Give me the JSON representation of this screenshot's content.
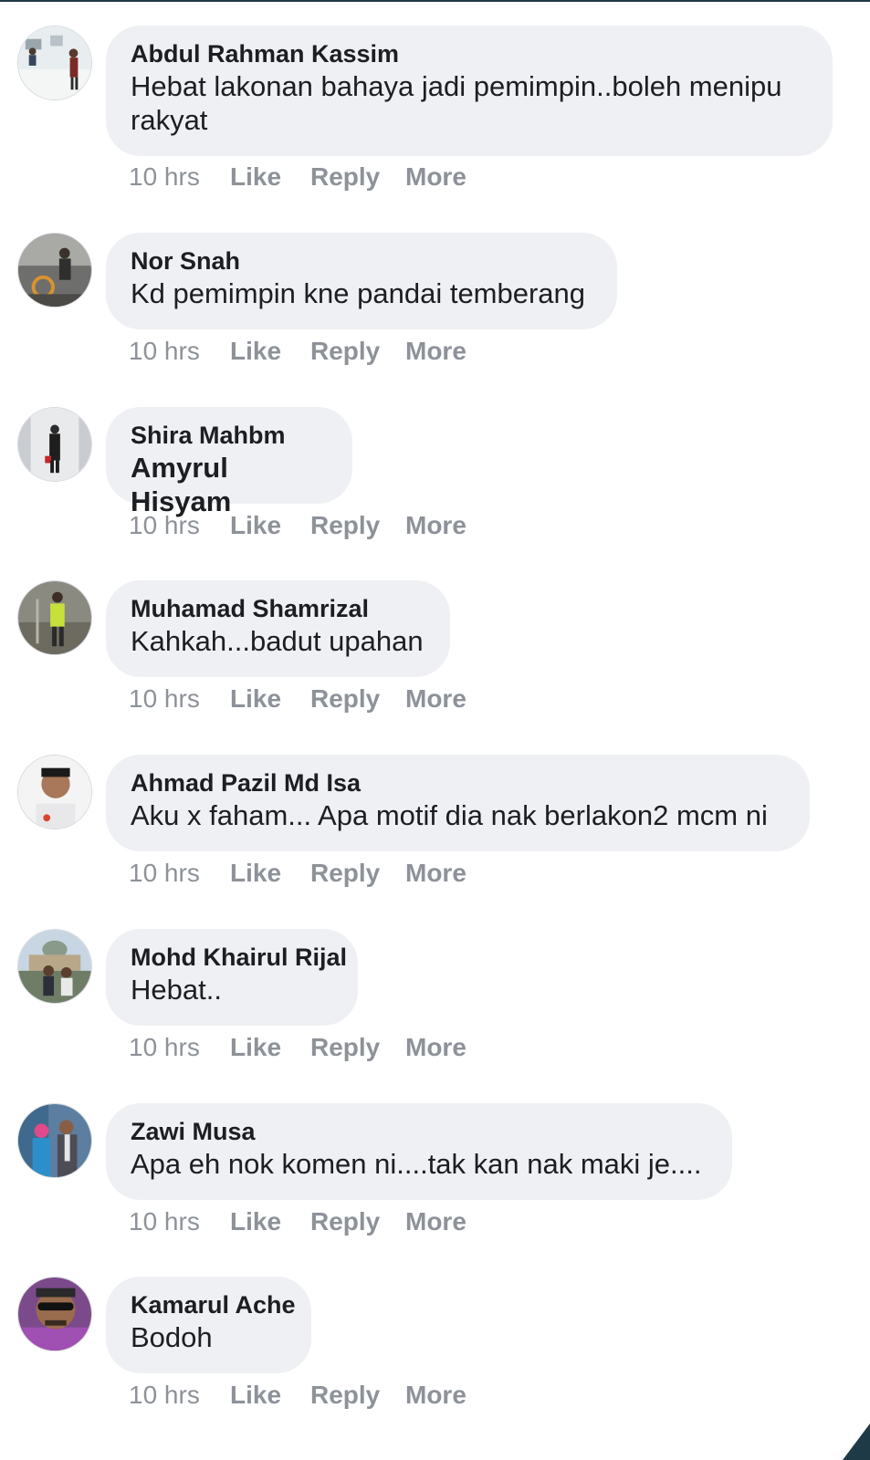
{
  "comments": [
    {
      "author": "Abdul Rahman Kassim",
      "text": "Hebat lakonan bahaya jadi pemimpin..boleh menipu rakyat",
      "time": "10 hrs",
      "like": "Like",
      "reply": "Reply",
      "more": "More"
    },
    {
      "author": "Nor Snah",
      "text": "Kd pemimpin kne pandai temberang",
      "time": "10 hrs",
      "like": "Like",
      "reply": "Reply",
      "more": "More"
    },
    {
      "author": "Shira Mahbm",
      "text": "Amyrul Hisyam",
      "time": "10 hrs",
      "like": "Like",
      "reply": "Reply",
      "more": "More"
    },
    {
      "author": "Muhamad Shamrizal",
      "text": "Kahkah...badut upahan",
      "time": "10 hrs",
      "like": "Like",
      "reply": "Reply",
      "more": "More"
    },
    {
      "author": "Ahmad Pazil Md Isa",
      "text": "Aku x faham... Apa motif dia nak berlakon2 mcm ni",
      "time": "10 hrs",
      "like": "Like",
      "reply": "Reply",
      "more": "More"
    },
    {
      "author": "Mohd Khairul Rijal",
      "text": "Hebat..",
      "time": "10 hrs",
      "like": "Like",
      "reply": "Reply",
      "more": "More"
    },
    {
      "author": "Zawi Musa",
      "text": "Apa eh nok komen ni....tak kan nak maki je....",
      "time": "10 hrs",
      "like": "Like",
      "reply": "Reply",
      "more": "More"
    },
    {
      "author": "Kamarul Ache",
      "text": "Bodoh",
      "time": "10 hrs",
      "like": "Like",
      "reply": "Reply",
      "more": "More"
    }
  ],
  "colors": {
    "bubble": "#eff0f3",
    "text": "#1c1e21",
    "meta": "#8d9299"
  }
}
